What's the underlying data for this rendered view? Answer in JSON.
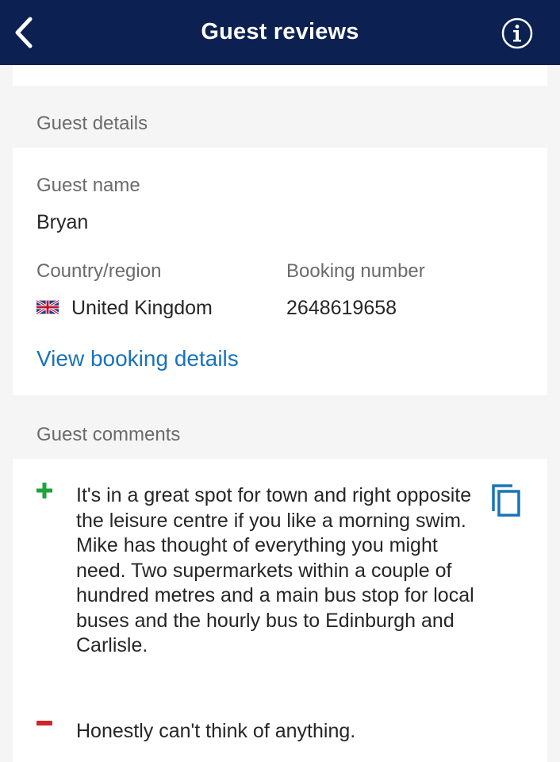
{
  "header": {
    "title": "Guest reviews",
    "back_icon": "chevron-left-icon",
    "info_icon": "info-icon"
  },
  "guest_details": {
    "section_title": "Guest details",
    "guest_name_label": "Guest name",
    "guest_name": "Bryan",
    "country_label": "Country/region",
    "country": "United Kingdom",
    "country_flag_icon": "uk-flag-icon",
    "booking_label": "Booking number",
    "booking_number": "2648619658",
    "view_booking_link": "View booking details"
  },
  "guest_comments": {
    "section_title": "Guest comments",
    "positive_icon": "plus-icon",
    "positive": "It's in a great spot for town and right opposite the leisure centre if you like a morning swim. Mike has thought of everything you might need. Two supermarkets within a couple of hundred metres and a main bus stop for local buses and the hourly bus to Edinburgh and Carlisle.",
    "negative_icon": "minus-icon",
    "negative": "Honestly can't think of anything.",
    "copy_icon": "copy-icon"
  },
  "colors": {
    "header_bg": "#0c2051",
    "link": "#1a73b8",
    "positive": "#1fa33a",
    "negative": "#d2242b",
    "background": "#f5f5f5"
  }
}
